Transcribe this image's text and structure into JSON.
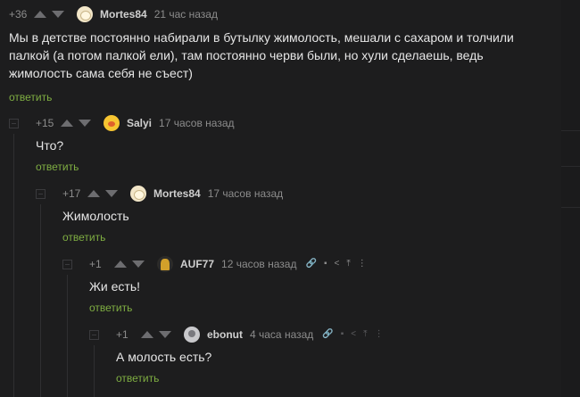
{
  "comments": [
    {
      "rating": "+36",
      "author": "Mortes84",
      "time": "21 час назад",
      "text_lines": [
        "Мы в детстве постоянно набирали в бутылку жимолость, мешали с сахаром и толчили",
        "палкой (а потом палкой ели), там постоянно черви были, но хули сделаешь, ведь",
        "жимолость сама себя не съест)"
      ],
      "reply": "ответить",
      "avatar_icon": "user-avatar-icon"
    },
    {
      "rating": "+15",
      "author": "Salyi",
      "time": "17 часов назад",
      "text_lines": [
        "Что?"
      ],
      "reply": "ответить",
      "avatar_icon": "user-avatar-icon"
    },
    {
      "rating": "+17",
      "author": "Mortes84",
      "time": "17 часов назад",
      "text_lines": [
        "Жимолость"
      ],
      "reply": "ответить",
      "avatar_icon": "user-avatar-icon"
    },
    {
      "rating": "+1",
      "author": "AUF77",
      "time": "12 часов назад",
      "text_lines": [
        "Жи есть!"
      ],
      "reply": "ответить",
      "avatar_icon": "user-avatar-icon",
      "tool_icons": [
        "link-icon",
        "save-icon",
        "share-icon",
        "scroll-up-icon",
        "more-icon"
      ]
    },
    {
      "rating": "+1",
      "author": "ebonut",
      "time": "4 часа назад",
      "text_lines": [
        "А молость есть?"
      ],
      "reply": "ответить",
      "avatar_icon": "user-avatar-icon",
      "tool_icons": [
        "link-icon",
        "save-icon",
        "share-icon",
        "scroll-up-icon",
        "more-icon"
      ]
    }
  ],
  "tool_glyphs": {
    "link": "🔗",
    "save": "▪",
    "share": "<",
    "up": "⤒",
    "more": "⋮"
  },
  "colors": {
    "background": "#1d1d1e",
    "reply": "#7fae42",
    "meta": "#8c8c8c",
    "text": "#e6e6e6"
  }
}
